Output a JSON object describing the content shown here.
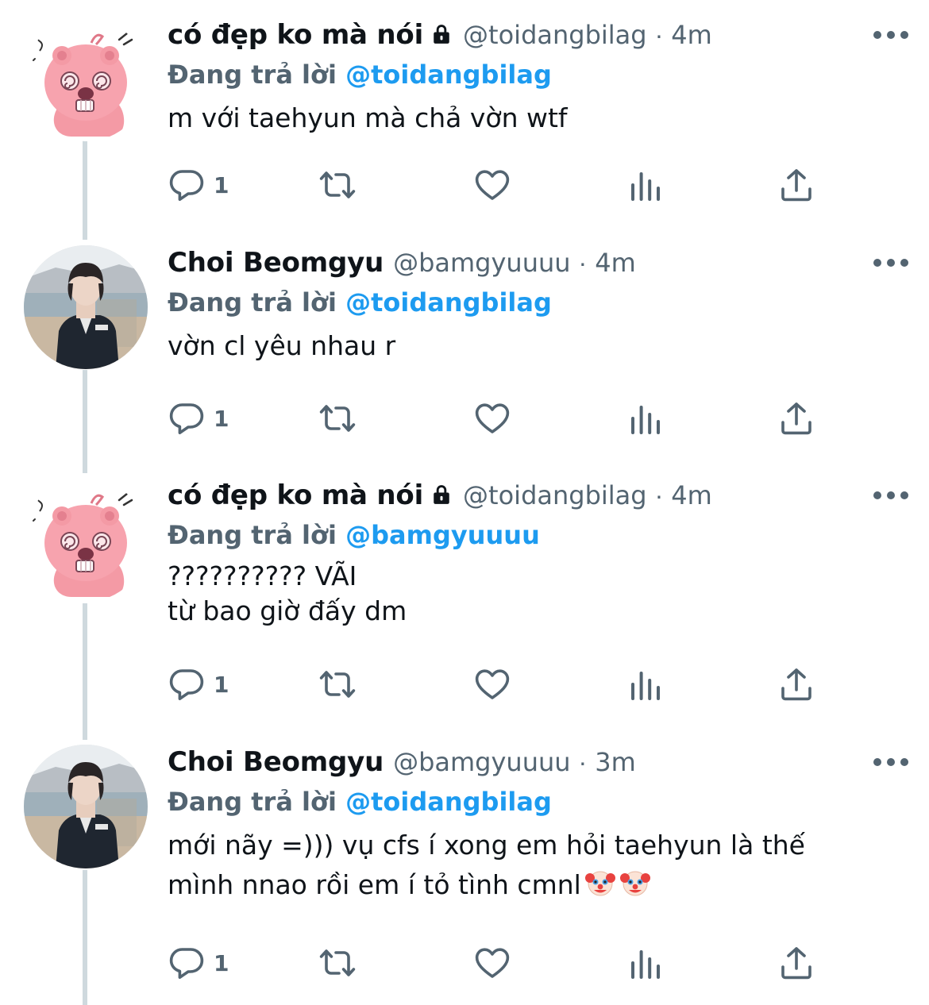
{
  "tweets": [
    {
      "name": "có đẹp ko mà nói",
      "locked": true,
      "handle": "@toidangbilag",
      "dot": "·",
      "time": "4m",
      "replying_label": "Đang trả lời",
      "replying_to": "@toidangbilag",
      "lines": [
        "m với taehyun mà chả vờn wtf"
      ],
      "reply_count": "1",
      "avatar": "loopy-avatar"
    },
    {
      "name": "Choi Beomgyu",
      "locked": false,
      "handle": "@bamgyuuuu",
      "dot": "·",
      "time": "4m",
      "replying_label": "Đang trả lời",
      "replying_to": "@toidangbilag",
      "lines": [
        "vờn cl yêu nhau r"
      ],
      "reply_count": "1",
      "avatar": "photo-avatar"
    },
    {
      "name": "có đẹp ko mà nói",
      "locked": true,
      "handle": "@toidangbilag",
      "dot": "·",
      "time": "4m",
      "replying_label": "Đang trả lời",
      "replying_to": "@bamgyuuuu",
      "lines": [
        "?????????? VÃI",
        "từ bao giờ đấy dm"
      ],
      "reply_count": "1",
      "avatar": "loopy-avatar"
    },
    {
      "name": "Choi Beomgyu",
      "locked": false,
      "handle": "@bamgyuuuu",
      "dot": "·",
      "time": "3m",
      "replying_label": "Đang trả lời",
      "replying_to": "@toidangbilag",
      "lines": [
        "mới nãy =))) vụ cfs í xong em hỏi taehyun là thế",
        "mình nnao rồi em í tỏ tình cmnl"
      ],
      "trailing_emoji": "clown-face",
      "reply_count": "1",
      "avatar": "photo-avatar"
    }
  ],
  "icons": {
    "reply": "reply-icon",
    "retweet": "retweet-icon",
    "like": "heart-icon",
    "analytics": "analytics-icon",
    "share": "share-icon",
    "more": "more-icon",
    "lock": "lock-icon"
  },
  "colors": {
    "accent": "#1d9bf0",
    "secondary": "#536471",
    "text": "#0f1419",
    "thread": "#cfd9de"
  }
}
